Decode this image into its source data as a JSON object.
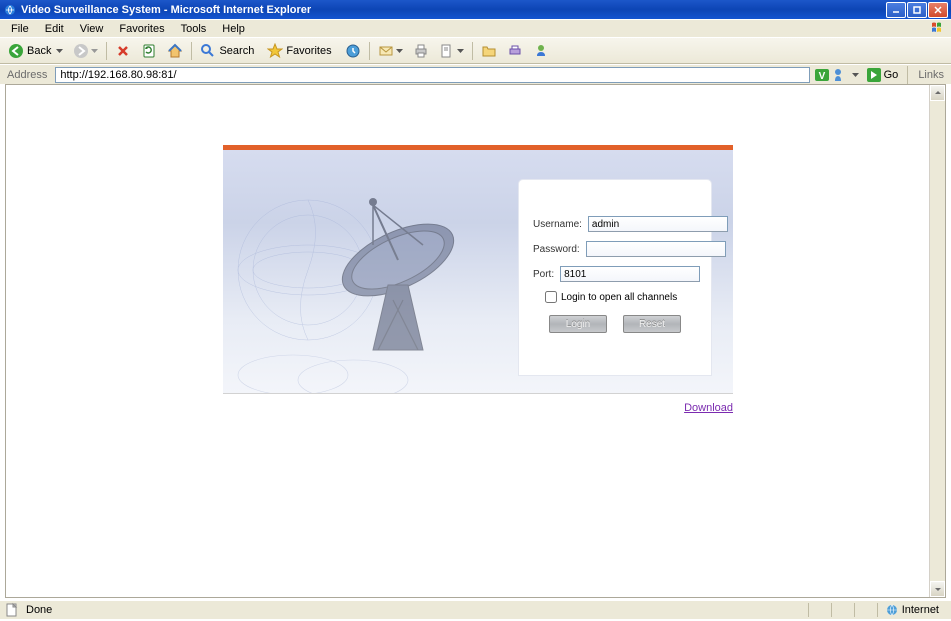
{
  "window": {
    "title": "Video Surveillance System - Microsoft Internet Explorer"
  },
  "menu": {
    "items": [
      "File",
      "Edit",
      "View",
      "Favorites",
      "Tools",
      "Help"
    ]
  },
  "toolbar": {
    "back_label": "Back",
    "search_label": "Search",
    "favorites_label": "Favorites"
  },
  "address": {
    "label": "Address",
    "url": "http://192.168.80.98:81/",
    "go_label": "Go",
    "links_label": "Links"
  },
  "login": {
    "username_label": "Username:",
    "username_value": "admin",
    "password_label": "Password:",
    "password_value": "",
    "port_label": "Port:",
    "port_value": "8101",
    "checkbox_label": "Login to open all channels",
    "login_btn": "Login",
    "reset_btn": "Reset"
  },
  "download": {
    "link_label": "Download"
  },
  "status": {
    "done": "Done",
    "zone": "Internet"
  }
}
